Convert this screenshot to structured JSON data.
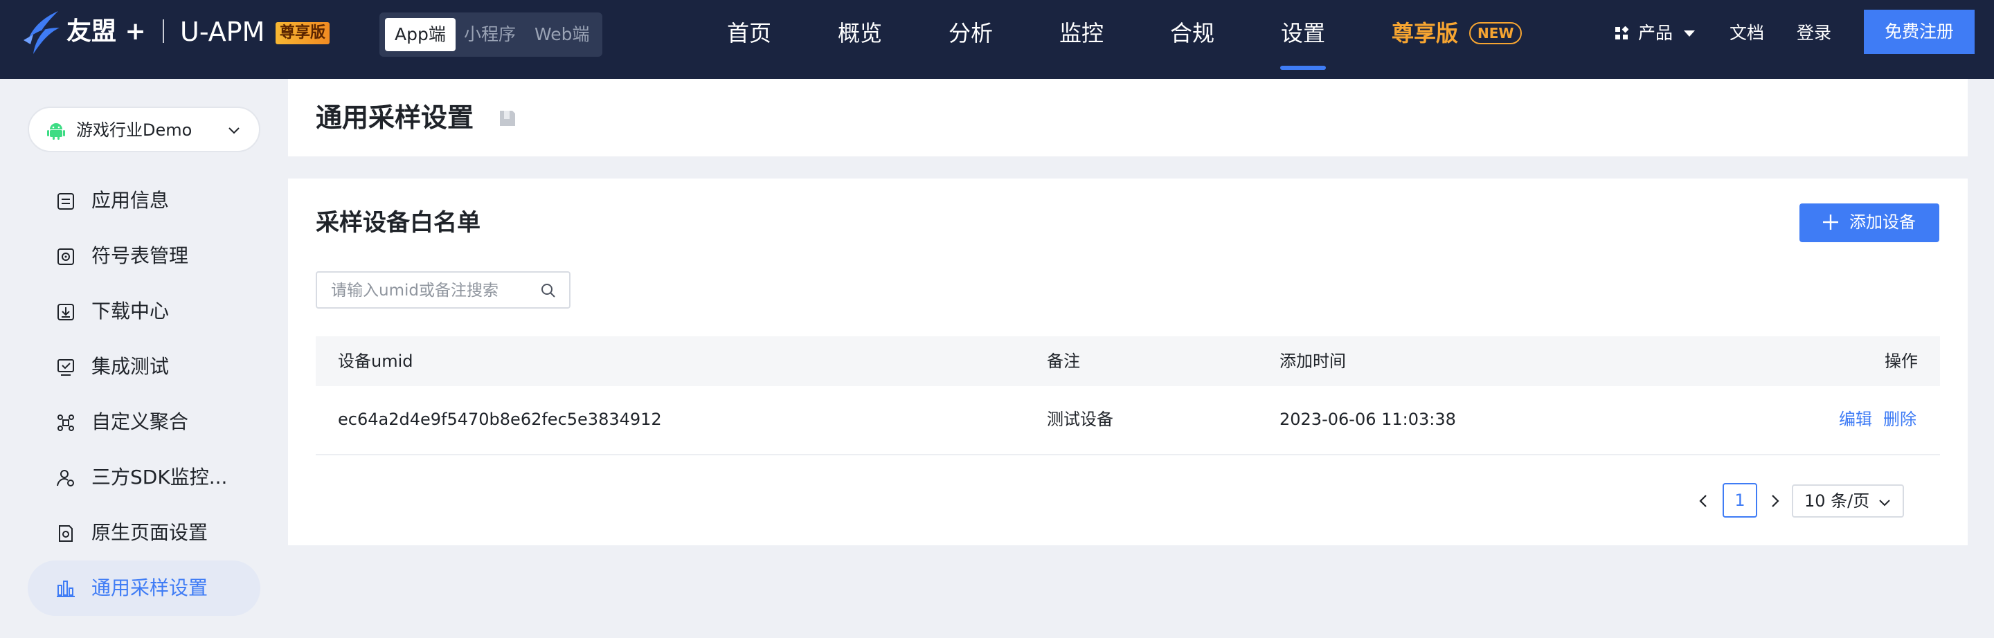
{
  "header": {
    "brand": "友盟 +",
    "product": "U-APM",
    "vip_badge": "尊享版",
    "platforms": [
      "App端",
      "小程序",
      "Web端"
    ],
    "nav": [
      "首页",
      "概览",
      "分析",
      "监控",
      "合规",
      "设置"
    ],
    "nav_vip": "尊享版",
    "new_badge": "NEW",
    "products_label": "产品",
    "docs_label": "文档",
    "login_label": "登录",
    "signup_label": "免费注册",
    "accent_color": "#3f7cf5",
    "vip_color": "#f7a531"
  },
  "sidebar": {
    "app_selector": "游戏行业Demo",
    "items": [
      {
        "label": "应用信息",
        "icon": "app-info-icon"
      },
      {
        "label": "符号表管理",
        "icon": "symbol-table-icon"
      },
      {
        "label": "下载中心",
        "icon": "download-icon"
      },
      {
        "label": "集成测试",
        "icon": "integration-test-icon"
      },
      {
        "label": "自定义聚合",
        "icon": "custom-aggregate-icon"
      },
      {
        "label": "三方SDK监控...",
        "icon": "third-party-sdk-icon"
      },
      {
        "label": "原生页面设置",
        "icon": "native-page-icon"
      },
      {
        "label": "通用采样设置",
        "icon": "sampling-icon"
      }
    ]
  },
  "main": {
    "page_title": "通用采样设置",
    "section_title": "采样设备白名单",
    "add_button": "添加设备",
    "search_placeholder": "请输入umid或备注搜索",
    "table": {
      "headers": [
        "设备umid",
        "备注",
        "添加时间",
        "操作"
      ],
      "rows": [
        {
          "umid": "ec64a2d4e9f5470b8e62fec5e3834912",
          "note": "测试设备",
          "time": "2023-06-06 11:03:38",
          "edit": "编辑",
          "delete": "删除"
        }
      ]
    },
    "pagination": {
      "page": "1",
      "page_size": "10 条/页"
    }
  }
}
